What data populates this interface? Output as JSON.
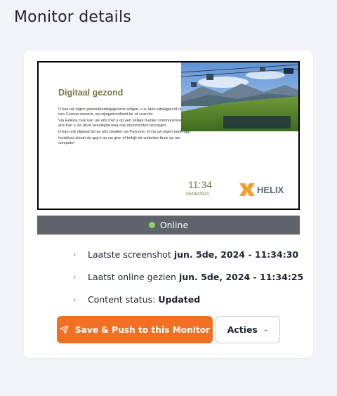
{
  "page": {
    "title": "Monitor details"
  },
  "screenshot": {
    "slide_title": "Digitaal gezond",
    "paragraphs": [
      "U kan uw eigen gezondheidsgegevens volgen, o.a. labo-uitslagen of uitslagen van Corona-wissers, op mijngezondheid.be of cozo.be",
      "Via Helena.care kan uw arts met u op een veilige manier communiceren en uw arts kan u via deze beveiligde weg ook documenten bezorgen",
      "U kan ook digitaal bij uw arts betalen via Payconic of via uw eigen bank-app",
      "Installeer alvast de app's op uw gsm of bekijk de websites thuis op uw computer"
    ],
    "time": "11:34",
    "date": "05/06/2024",
    "logo_text": "HELIX"
  },
  "status": {
    "label": "Online",
    "color": "#8cd06a"
  },
  "info": [
    {
      "label": "Laatste screenshot",
      "value": "jun. 5de, 2024 - 11:34:30"
    },
    {
      "label": "Laatst online gezien",
      "value": "jun. 5de, 2024 - 11:34:25"
    },
    {
      "label": "Content status:",
      "value": "Updated"
    }
  ],
  "actions": {
    "primary_label": "Save & Push to this Monitor",
    "primary_icon": "send-icon",
    "secondary_label": "Acties",
    "secondary_icon": "chevron-down-icon",
    "accent": "#f36f23"
  }
}
